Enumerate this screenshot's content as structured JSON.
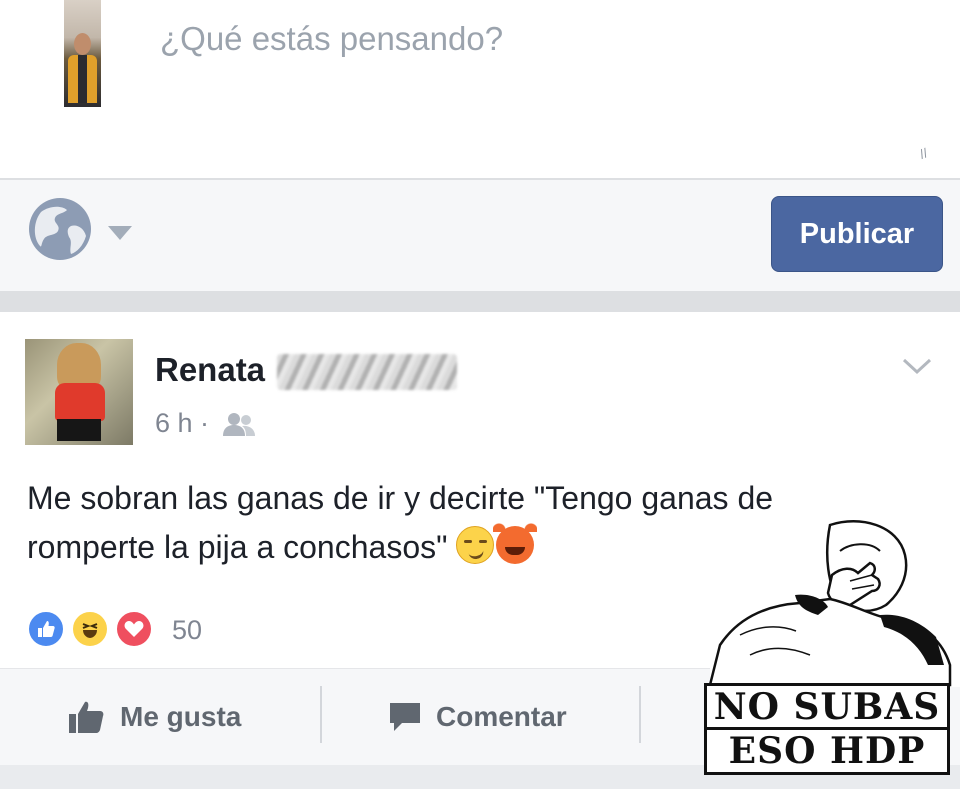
{
  "composer": {
    "placeholder": "¿Qué estás pensando?",
    "publish_label": "Publicar"
  },
  "post": {
    "author": "Renata",
    "time": "6 h ·",
    "text": "Me sobran las ganas de ir y decirte \"Tengo ganas de romperte la pija a conchasos\"",
    "reaction_count": "50"
  },
  "actions": {
    "like_label": "Me gusta",
    "comment_label": "Comentar"
  },
  "meme": {
    "line1": "NO SUBAS",
    "line2": "ESO HDP"
  },
  "colors": {
    "publish_bg": "#4b67a1",
    "toolbar_bg": "#f6f7f9",
    "divider": "#dddfe2"
  }
}
